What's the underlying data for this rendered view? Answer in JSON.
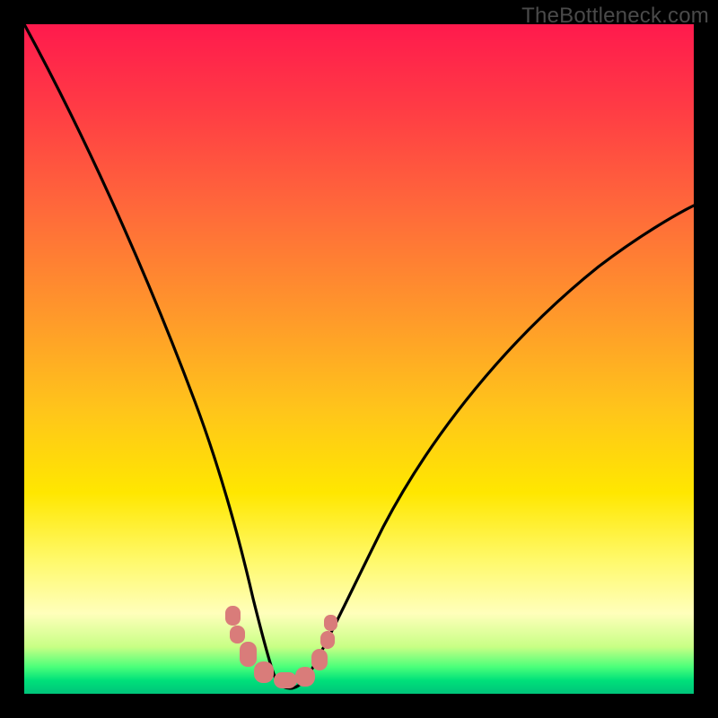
{
  "watermark": "TheBottleneck.com",
  "chart_data": {
    "type": "line",
    "title": "",
    "xlabel": "",
    "ylabel": "",
    "xlim": [
      0,
      100
    ],
    "ylim": [
      0,
      100
    ],
    "legend": false,
    "grid": false,
    "background_gradient_top_to_bottom": [
      "#ff1a4d",
      "#ff9a2a",
      "#ffe700",
      "#ffffbb",
      "#00c47a"
    ],
    "series": [
      {
        "name": "primary-curve",
        "color": "#000000",
        "x": [
          0,
          5,
          10,
          15,
          20,
          25,
          28,
          30,
          32,
          34,
          36,
          37,
          38,
          40,
          42,
          44,
          48,
          55,
          65,
          80,
          95,
          100
        ],
        "y": [
          100,
          90,
          79,
          67,
          55,
          40,
          30,
          22,
          15,
          9,
          4,
          2,
          1.0,
          1.0,
          2,
          4,
          9,
          18,
          33,
          52,
          68,
          72
        ]
      },
      {
        "name": "marker-cluster",
        "color": "#d97c7a",
        "type": "scatter",
        "marker": "rounded-rect",
        "x": [
          31,
          31.5,
          34,
          36,
          38,
          40,
          42,
          43,
          43.5
        ],
        "y": [
          11,
          9,
          4,
          2,
          1.2,
          1.2,
          3,
          6,
          8
        ]
      }
    ]
  },
  "colors": {
    "frame": "#000000",
    "marker": "#d97c7a",
    "curve": "#000000"
  }
}
